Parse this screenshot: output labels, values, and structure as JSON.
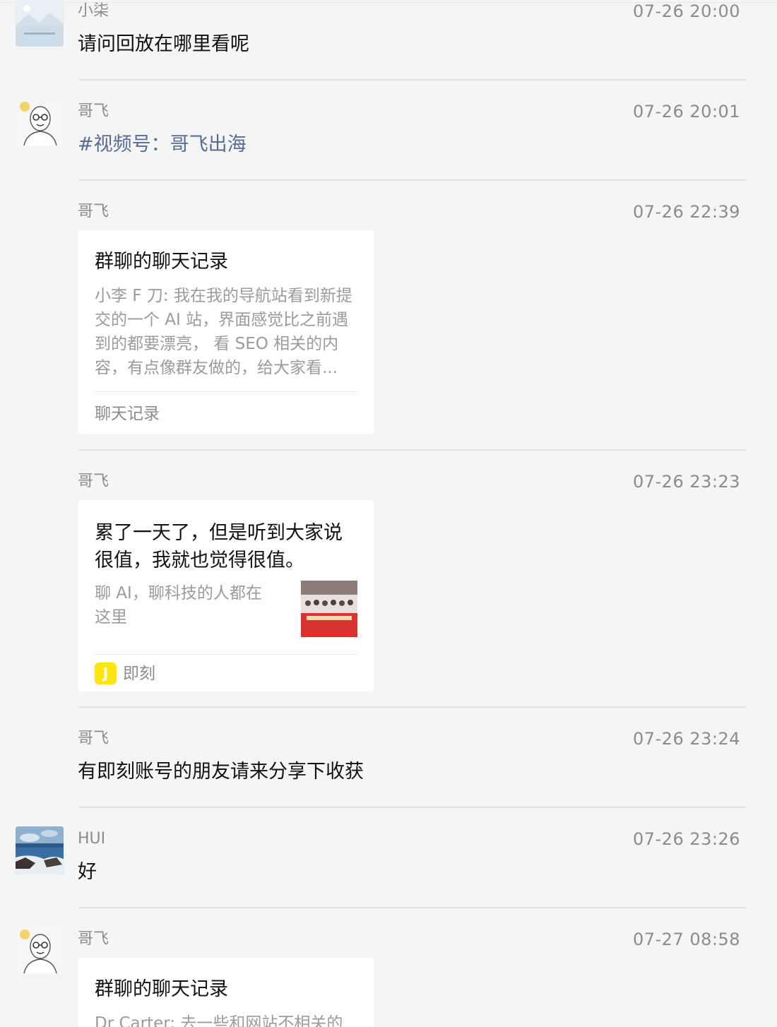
{
  "messages": [
    {
      "sender": "小柒",
      "time": "07-26 20:00",
      "text": "请问回放在哪里看呢"
    },
    {
      "sender": "哥飞",
      "time": "07-26 20:01",
      "text": "#视频号：哥飞出海"
    },
    {
      "sender": "哥飞",
      "time": "07-26 22:39",
      "card": {
        "title": "群聊的聊天记录",
        "desc_lines": [
          "小李 F 刀: 我在我的导航站看到新提",
          "交的一个 AI 站，界面感觉比之前遇",
          "到的都要漂亮， 看 SEO 相关的内",
          "容，有点像群友做的，给大家看..."
        ],
        "footer": "聊天记录"
      }
    },
    {
      "sender": "哥飞",
      "time": "07-26 23:23",
      "card": {
        "title_lines": [
          "累了一天了，但是听到大家说",
          "很值，我就也觉得很值。"
        ],
        "desc_lines": [
          "聊 AI，聊科技的人都在",
          "这里"
        ],
        "footer": "即刻",
        "footer_icon": "J",
        "footer_icon_color": "#ffe411"
      }
    },
    {
      "sender": "哥飞",
      "time": "07-26 23:24",
      "text": "有即刻账号的朋友请来分享下收获"
    },
    {
      "sender": "HUI",
      "time": "07-26 23:26",
      "text": "好"
    },
    {
      "sender": "哥飞",
      "time": "07-27 08:58",
      "card": {
        "title": "群聊的聊天记录",
        "desc_lines": [
          "Dr Carter: 去一些和网站不相关的"
        ]
      }
    }
  ],
  "colors": {
    "link": "#576b95",
    "background": "#f5f5f5"
  }
}
